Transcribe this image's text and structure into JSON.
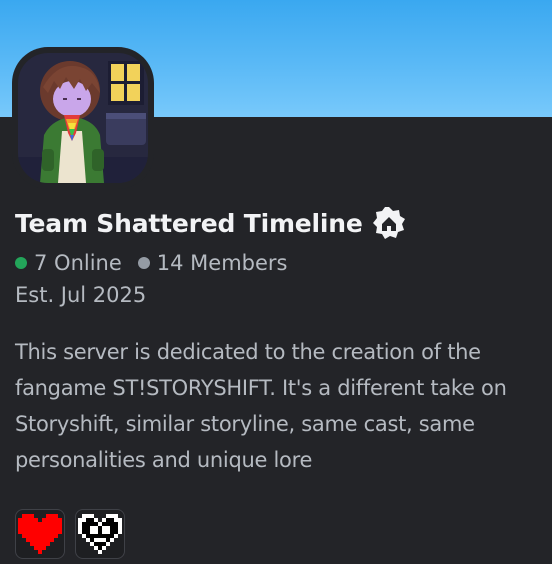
{
  "server": {
    "name": "Team Shattered Timeline",
    "online_count": "7 Online",
    "member_count": "14 Members",
    "established": "Est. Jul 2025",
    "description": "This server is dedicated to the creation of the fangame ST!STORYSHIFT. It's a different take on Storyshift, similar storyline, same cast, same personalities and unique lore"
  },
  "icons": {
    "server_icon": "server-avatar-icon",
    "badge": "community-badge-icon",
    "emojis": [
      "red-heart-emoji",
      "monster-soul-emoji"
    ]
  },
  "colors": {
    "banner": "#4fb4f5",
    "card_background": "#232428",
    "online": "#23a55a",
    "members": "#949ba4",
    "heart": "#ff0000"
  }
}
